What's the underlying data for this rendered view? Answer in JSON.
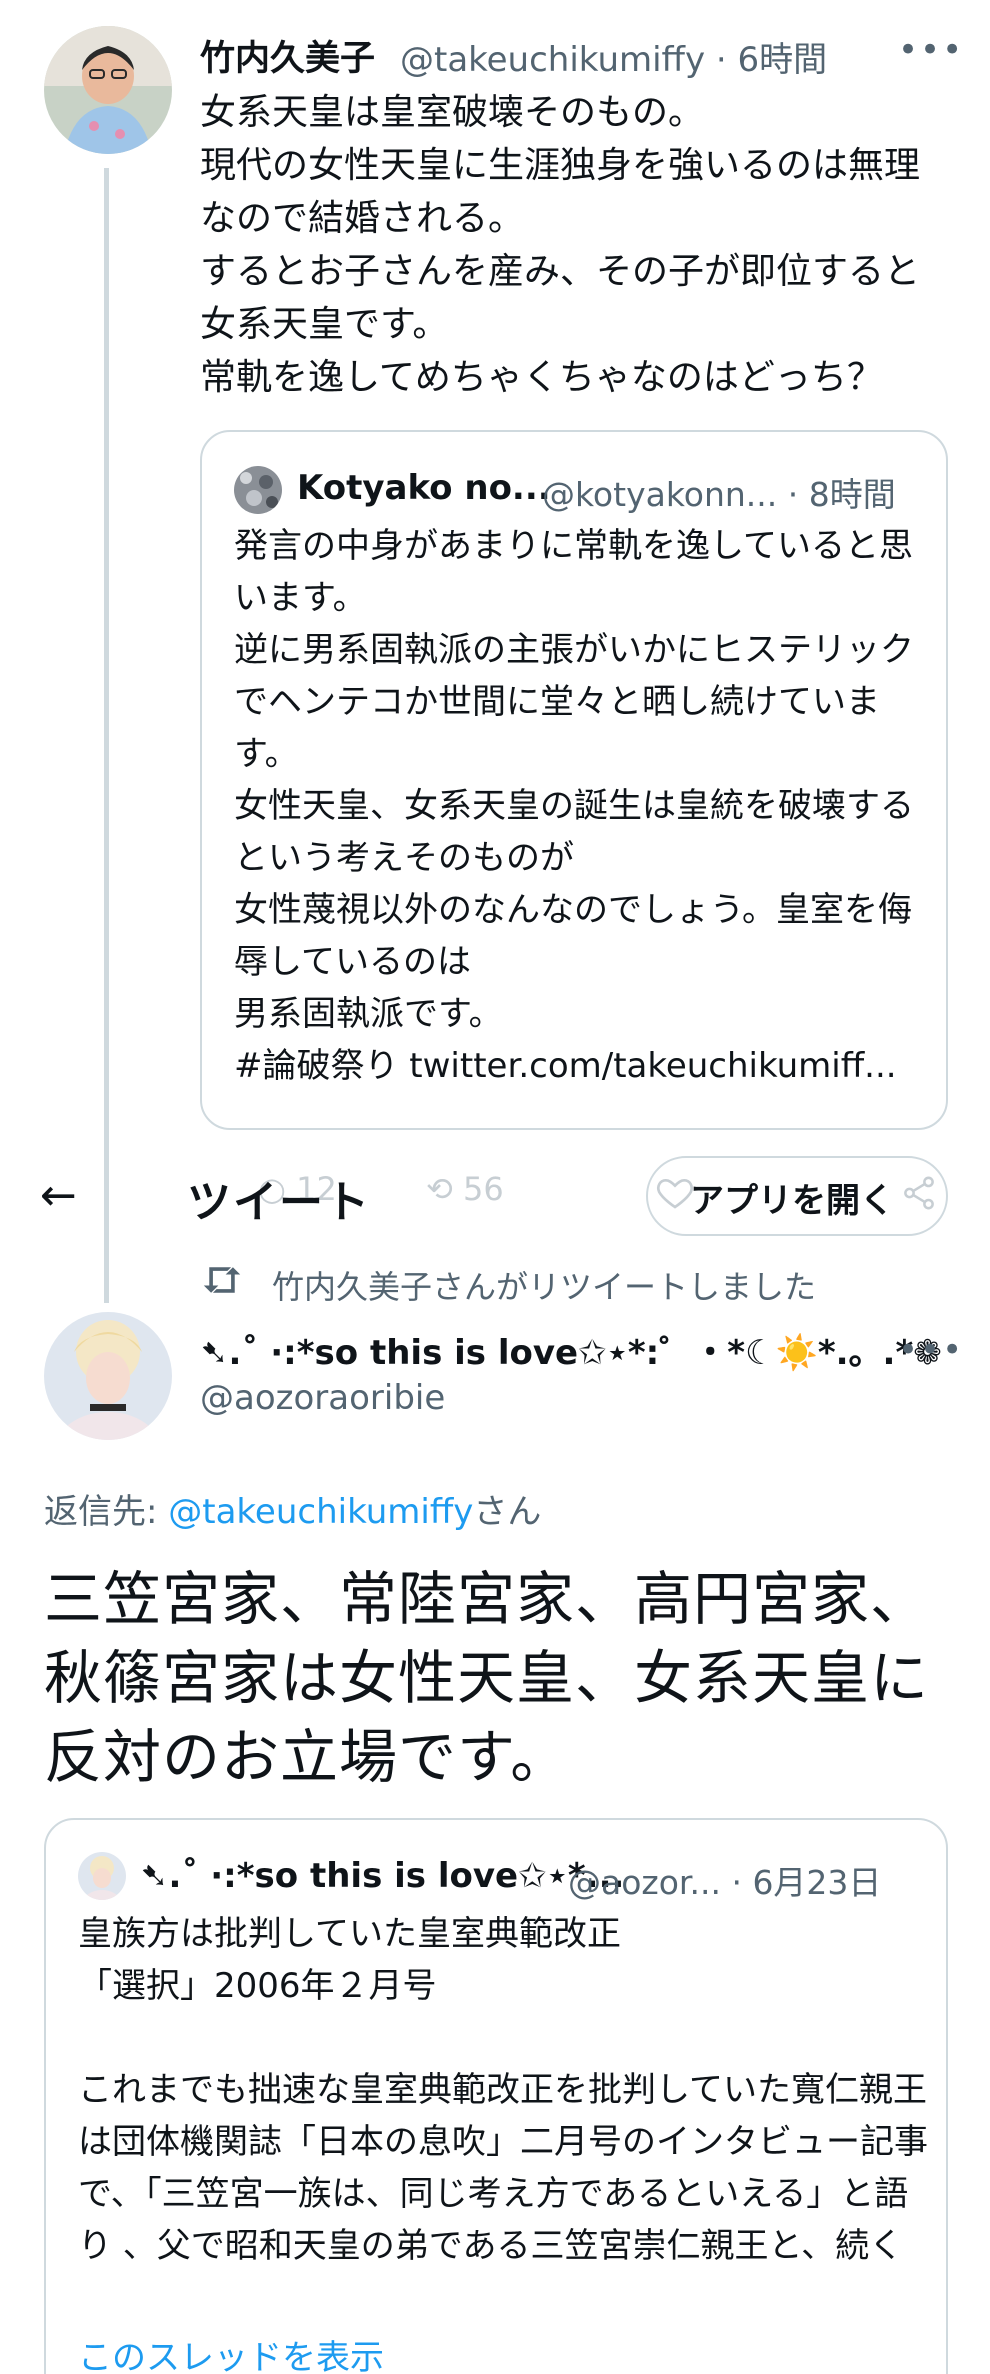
{
  "tweet1": {
    "display_name": "竹内久美子",
    "handle": "@takeuchikumiffy",
    "separator": "·",
    "time": "6時間",
    "more": "•••",
    "body": "女系天皇は皇室破壊そのもの。\n現代の女性天皇に生涯独身を強いるのは無理なので結婚される。\nするとお子さんを産み、その子が即位すると女系天皇です。\n常軌を逸してめちゃくちゃなのはどっち？",
    "quote": {
      "display_name": "Kotyako no...",
      "handle": "@kotyakonn...",
      "separator": "·",
      "time": "8時間",
      "body": "発言の中身があまりに常軌を逸していると思います。\n逆に男系固執派の主張がいかにヒステリックでヘンテコか世間に堂々と晒し続けています。\n女性天皇、女系天皇の誕生は皇統を破壊するという考えそのものが\n女性蔑視以外のなんなのでしょう。皇室を侮辱しているのは\n男系固執派です。\n#論破祭り twitter.com/takeuchikumiff..."
    },
    "actions": {
      "reply_count": "12",
      "retweet_count": "56"
    }
  },
  "header": {
    "back_icon": "←",
    "title": "ツイート",
    "open_app_label": "アプリを開く"
  },
  "retweet_notice": "竹内久美子さんがリツイートしました",
  "tweet2": {
    "display_name": "➷.˚ ·:*so this is love✩⋆*:゜・*☾☀️*.。.*❁",
    "handle": "@aozoraoribie",
    "more": "•••",
    "reply_prefix": "返信先: ",
    "reply_link": "@takeuchikumiffy",
    "reply_suffix": "さん",
    "body": "三笠宮家、常陸宮家、高円宮家、秋篠宮家は女性天皇、女系天皇に反対のお立場です。",
    "quote": {
      "display_name": "➷.˚ ·:*so this is love✩⋆*...",
      "handle": "@aozor...",
      "separator": "·",
      "time": "6月23日",
      "body": "皇族方は批判していた皇室典範改正\n「選択」2006年２月号\n\nこれまでも拙速な皇室典範改正を批判していた寬仁親王は団体機関誌「日本の息吹」二月号のインタビュー記事で、「三笠宮一族は、同じ考え方であるといえる」と語り 、父で昭和天皇の弟である三笠宮崇仁親王と、続く",
      "show_thread": "このスレッドを表示"
    }
  },
  "colors": {
    "text": "#0f1419",
    "muted": "#536471",
    "link": "#1d9bf0",
    "border": "#cfd9de"
  }
}
